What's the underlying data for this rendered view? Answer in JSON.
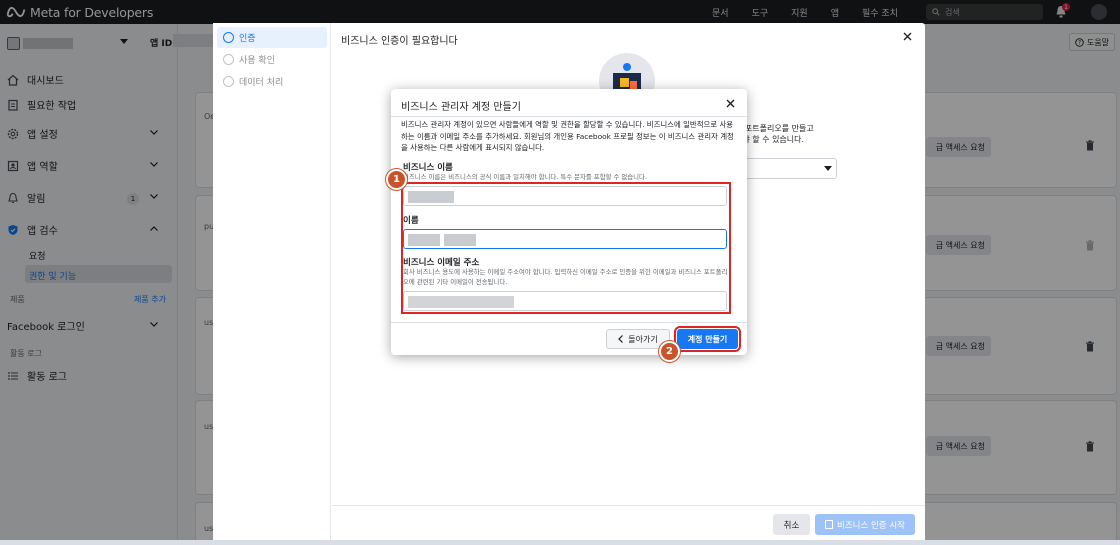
{
  "topbar": {
    "brand": "Meta for Developers",
    "nav": [
      "문서",
      "도구",
      "지원",
      "앱",
      "필수 조치"
    ],
    "search_placeholder": "검색",
    "notification_count": "1"
  },
  "sidebar": {
    "app_id_label": "앱 ID:",
    "help": "도움말",
    "items": [
      {
        "label": "대시보드",
        "icon": "home-icon"
      },
      {
        "label": "필요한 작업",
        "icon": "clipboard-icon"
      },
      {
        "label": "앱 설정",
        "icon": "gear-icon"
      },
      {
        "label": "앱 역할",
        "icon": "person-badge-icon"
      },
      {
        "label": "알림",
        "icon": "bell-icon",
        "count": "1"
      },
      {
        "label": "앱 검수",
        "icon": "shield-icon"
      }
    ],
    "sub_items": [
      "요청",
      "권한 및 기능"
    ],
    "products_section": "제품",
    "add_product": "제품 추가",
    "facebook_login": "Facebook 로그인",
    "activity_section": "활동 로그",
    "activity_item": "활동 로그"
  },
  "background": {
    "card_prefixes": [
      "Oe",
      "pu",
      "us",
      "us",
      "us"
    ],
    "request_label": "급 액세스 요청"
  },
  "outer_dialog": {
    "title": "비즈니스 인증이 필요합니다",
    "steps": [
      "인증",
      "사용 확인",
      "데이터 처리"
    ],
    "side_text_1": "스 포트폴리오를 만들고",
    "side_text_2": "해야 할 수 있습니다.",
    "cancel": "취소",
    "start": "비즈니스 인증 시작"
  },
  "modal": {
    "title": "비즈니스 관리자 계정 만들기",
    "description": "비즈니스 관리자 계정이 있으면 사람들에게 역할 및 권한을 할당할 수 있습니다. 비즈니스에 일반적으로 사용하는 이름과 이메일 주소를 추가하세요. 회원님의 개인용 Facebook 프로필 정보는 이 비즈니스 관리자 계정을 사용하는 다른 사람에게 표시되지 않습니다.",
    "business_name_label": "비즈니스 이름",
    "business_name_hint": "비즈니스 이름은 비즈니스의 공식 이름과 일치해야 합니다. 특수 문자를 포함할 수 없습니다.",
    "name_label": "이름",
    "email_label": "비즈니스 이메일 주소",
    "email_hint": "회사 비즈니스 용도에 사용하는 이메일 주소여야 합니다. 입력하신 이메일 주소로 인증을 위한 이메일과 비즈니스 포트폴리오에 관련된 기타 이메일이 전송됩니다.",
    "back": "돌아가기",
    "create": "계정 만들기"
  },
  "annotations": [
    "1",
    "2"
  ],
  "colors": {
    "accent": "#1877f2",
    "highlight": "#e02424",
    "marker": "#c8542c"
  }
}
